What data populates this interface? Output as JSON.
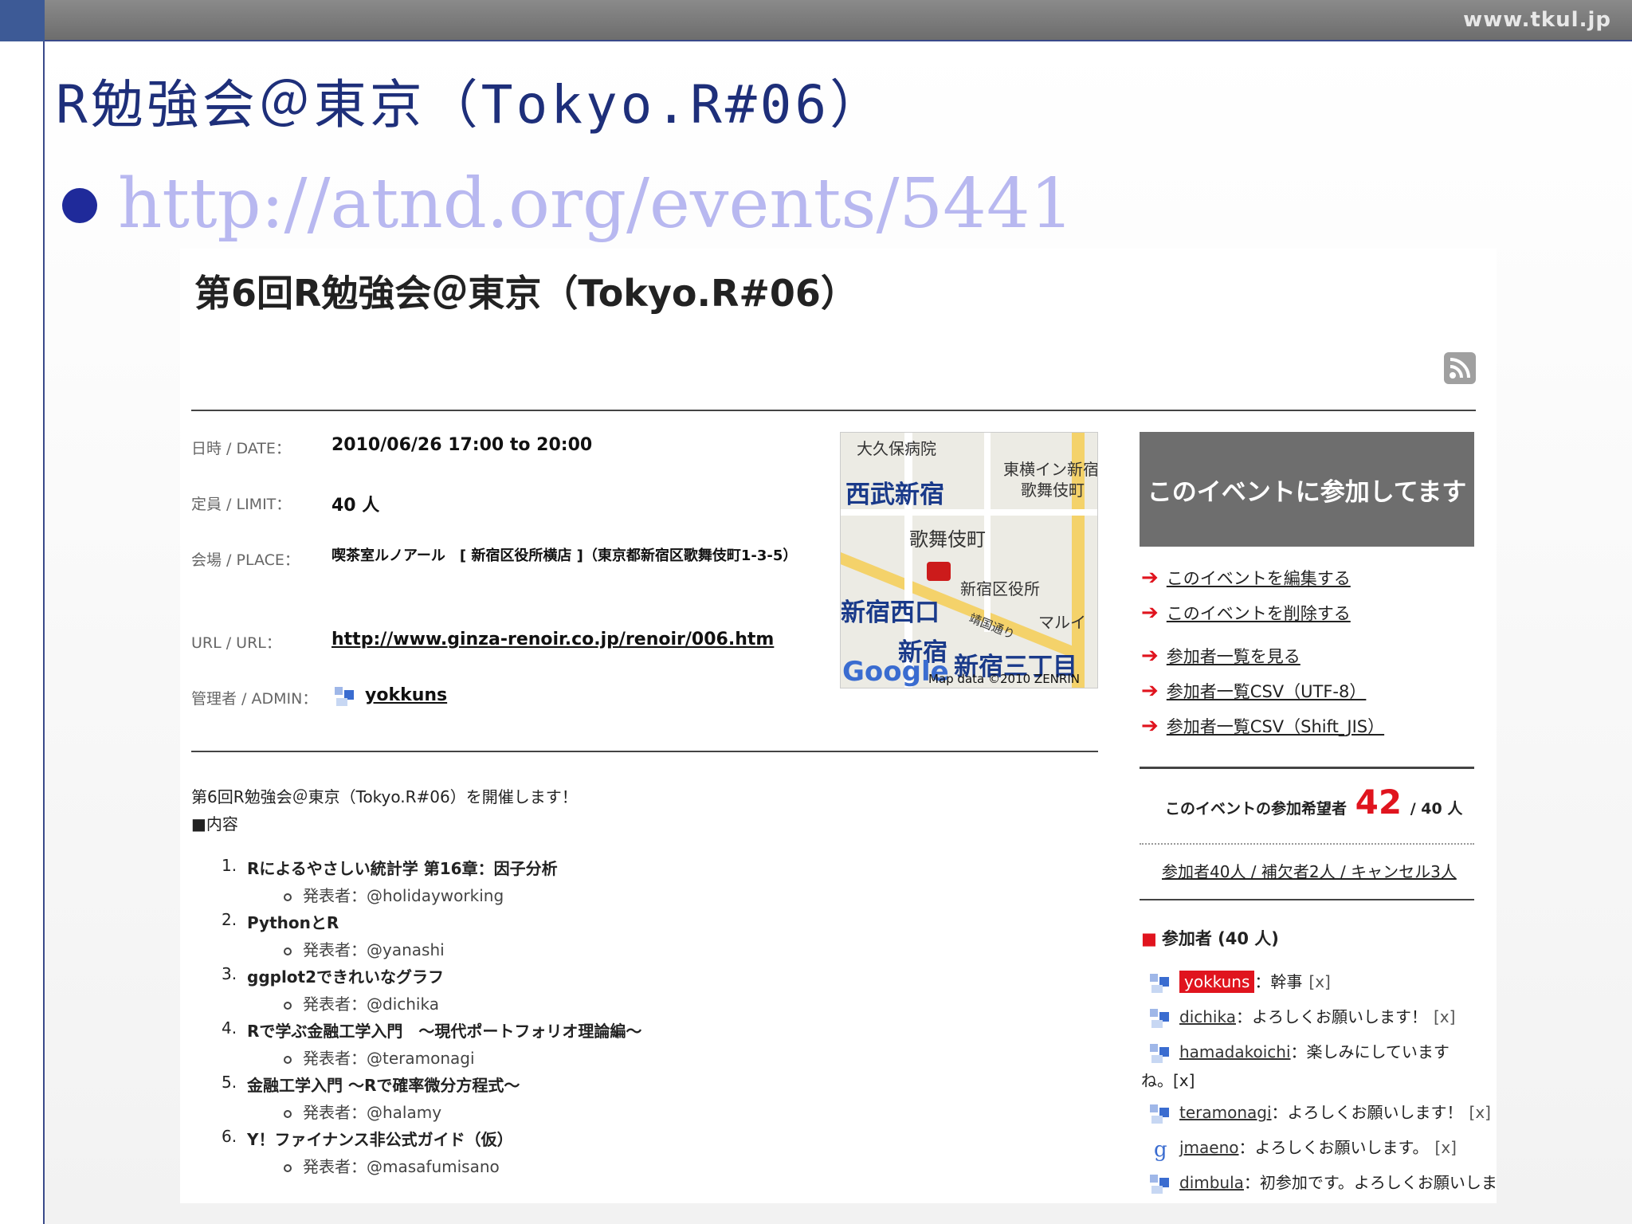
{
  "slide": {
    "site_url": "www.tkul.jp",
    "title": "R勉強会＠東京（Tokyo.R#06）",
    "bullet_link": "http://atnd.org/events/5441"
  },
  "event": {
    "title": "第6回R勉強会＠東京（Tokyo.R#06）",
    "info": [
      {
        "label": "日時 / DATE：",
        "value": "2010/06/26 17:00 to 20:00"
      },
      {
        "label": "定員 / LIMIT：",
        "value": "40 人"
      },
      {
        "label": "会場 / PLACE：",
        "value": "喫茶室ルノアール　[ 新宿区役所横店 ]（東京都新宿区歌舞伎町1-3-5）"
      },
      {
        "label": "URL / URL：",
        "value": "http://www.ginza-renoir.co.jp/renoir/006.htm"
      },
      {
        "label": "管理者 / ADMIN：",
        "value": "yokkuns"
      }
    ],
    "map": {
      "labels": [
        "大久保病院",
        "東横イン新宿",
        "歌舞伎町",
        "西武新宿",
        "歌舞伎町",
        "新宿区役所",
        "新宿西口",
        "靖国通り",
        "マルイ",
        "新宿",
        "新宿三丁目"
      ],
      "brand": "Google",
      "credit": "Map data ©2010 ZENRIN"
    },
    "description": {
      "intro": "第6回R勉強会＠東京（Tokyo.R#06）を開催します！",
      "section": "■内容",
      "items": [
        {
          "num": "1.",
          "title": "Rによるやさしい統計学 第16章：因子分析",
          "presenter": "発表者：@holidayworking"
        },
        {
          "num": "2.",
          "title": "PythonとR",
          "presenter": "発表者：@yanashi"
        },
        {
          "num": "3.",
          "title": "ggplot2できれいなグラフ",
          "presenter": "発表者：@dichika"
        },
        {
          "num": "4.",
          "title": "Rで学ぶ金融工学入門　～現代ポートフォリオ理論編～",
          "presenter": "発表者：@teramonagi"
        },
        {
          "num": "5.",
          "title": "金融工学入門 ～Rで確率微分方程式～",
          "presenter": "発表者：@halamy"
        },
        {
          "num": "6.",
          "title": "Y！ファイナンス非公式ガイド（仮）",
          "presenter": "発表者：@masafumisano"
        }
      ]
    },
    "sidebar": {
      "join_label": "このイベントに参加してます",
      "actions": [
        "このイベントを編集する",
        "このイベントを削除する",
        "参加者一覧を見る",
        "参加者一覧CSV（UTF-8）",
        "参加者一覧CSV（Shift_JIS）"
      ],
      "applicants_label": "このイベントの参加希望者",
      "applicants_count": "42",
      "applicants_limit": "/ 40 人",
      "sub_counts": "参加者40人 / 補欠者2人 / キャンセル3人",
      "participants_head": "参加者 (40 人)",
      "participants": [
        {
          "name": "yokkuns",
          "message": "：幹事",
          "x": "[x]",
          "highlight": true
        },
        {
          "name": "dichika",
          "message": "：よろしくお願いします！",
          "x": "[x]",
          "highlight": false
        },
        {
          "name": "hamadakoichi",
          "message": "：楽しみにしています",
          "x": "",
          "highlight": false
        },
        {
          "name": "teramonagi",
          "message": "：よろしくお願いします！",
          "x": "[x]",
          "highlight": false
        },
        {
          "name": "jmaeno",
          "message": "：よろしくお願いします。",
          "x": "[x]",
          "highlight": false
        },
        {
          "name": "dimbula",
          "message": "：初参加です。よろしくお願いしま",
          "x": "",
          "highlight": false
        }
      ],
      "wrap_text": "ね。[x]"
    }
  }
}
